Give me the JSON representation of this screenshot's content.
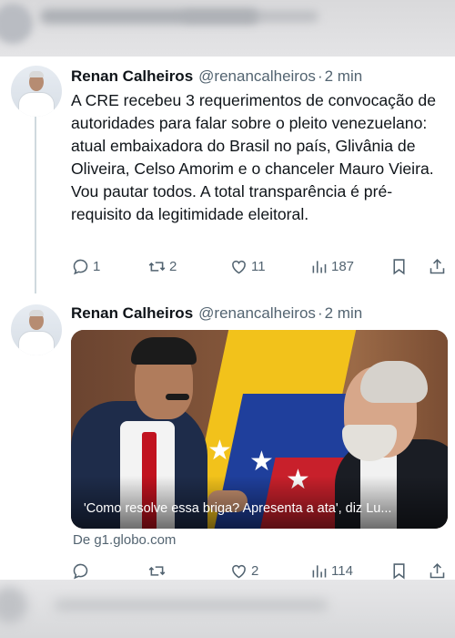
{
  "tweets": [
    {
      "author": "Renan Calheiros",
      "handle": "@renancalheiros",
      "separator": "·",
      "time": "2 min",
      "text": "A CRE recebeu 3 requerimentos de convocação de autoridades para falar sobre o pleito venezuelano: atual embaixadora do Brasil no país, Glivânia de Oliveira, Celso Amorim e o chanceler Mauro Vieira. Vou pautar todos. A total transparência é pré-requisito da legitimidade eleitoral.",
      "replies": "1",
      "retweets": "2",
      "likes": "11",
      "views": "187"
    },
    {
      "author": "Renan Calheiros",
      "handle": "@renancalheiros",
      "separator": "·",
      "time": "2 min",
      "media_caption": "'Como resolve essa briga? Apresenta a ata', diz Lu...",
      "source": "De g1.globo.com",
      "replies": "",
      "retweets": "",
      "likes": "2",
      "views": "114"
    }
  ],
  "icons": {
    "reply": "reply-icon",
    "retweet": "retweet-icon",
    "like": "heart-icon",
    "views": "views-chart-icon",
    "bookmark": "bookmark-icon",
    "share": "share-icon"
  },
  "colors": {
    "text": "#0f1419",
    "secondary": "#536471",
    "thread_line": "#cfd9de"
  }
}
